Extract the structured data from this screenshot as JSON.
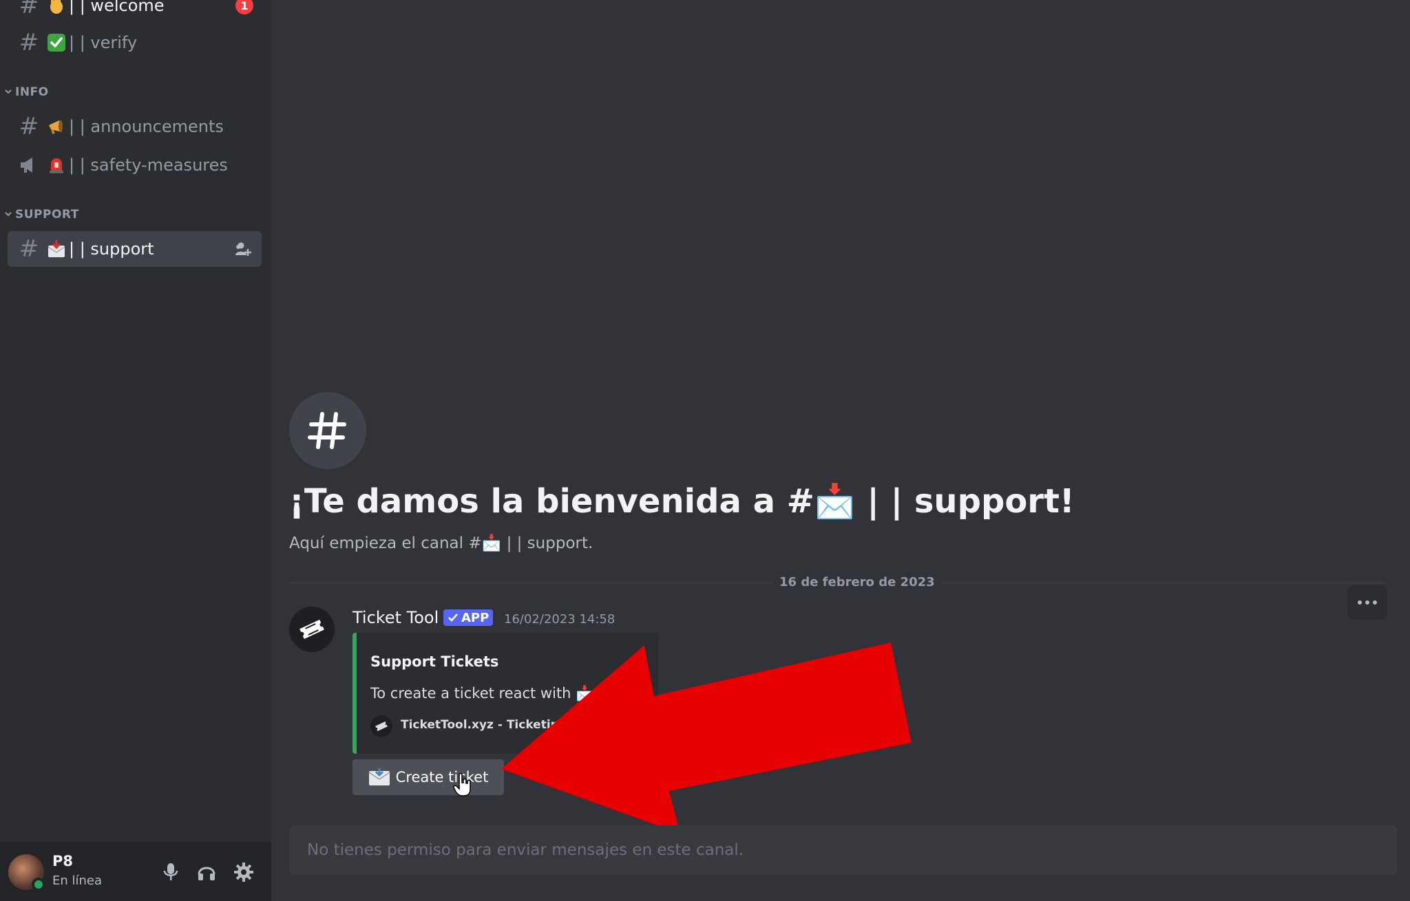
{
  "sidebar": {
    "channels": [
      {
        "name": "👋 | | welcome",
        "label": "| | welcome",
        "badge": "1"
      },
      {
        "name": "✅ | | verify",
        "label": "| | verify"
      }
    ],
    "categories": {
      "info": {
        "label": "INFO",
        "channels": [
          {
            "label": "| | announcements"
          },
          {
            "label": "| | safety-measures"
          }
        ]
      },
      "support": {
        "label": "SUPPORT",
        "channels": [
          {
            "label": "| | support"
          }
        ]
      }
    }
  },
  "user_panel": {
    "name": "P8",
    "status": "En línea"
  },
  "main": {
    "welcome_title": "¡Te damos la bienvenida a #📩 | | support!",
    "welcome_subtitle": "Aquí empieza el canal #📩 | | support.",
    "date_divider": "16 de febrero de 2023",
    "message": {
      "author": "Ticket Tool",
      "tag": "APP",
      "timestamp": "16/02/2023 14:58",
      "embed": {
        "title": "Support Tickets",
        "description": "To create a ticket react with 📩",
        "footer": "TicketTool.xyz - Ticketing"
      },
      "button_label": "Create ticket"
    },
    "composer_placeholder": "No tienes permiso para enviar mensajes en este canal."
  },
  "colors": {
    "background": "#313338",
    "sidebar": "#2b2d31",
    "accent_blurple": "#5865f2",
    "embed_border": "#3ba55c",
    "arrow": "#e60000",
    "badge": "#f23f42",
    "online": "#23a55a"
  }
}
